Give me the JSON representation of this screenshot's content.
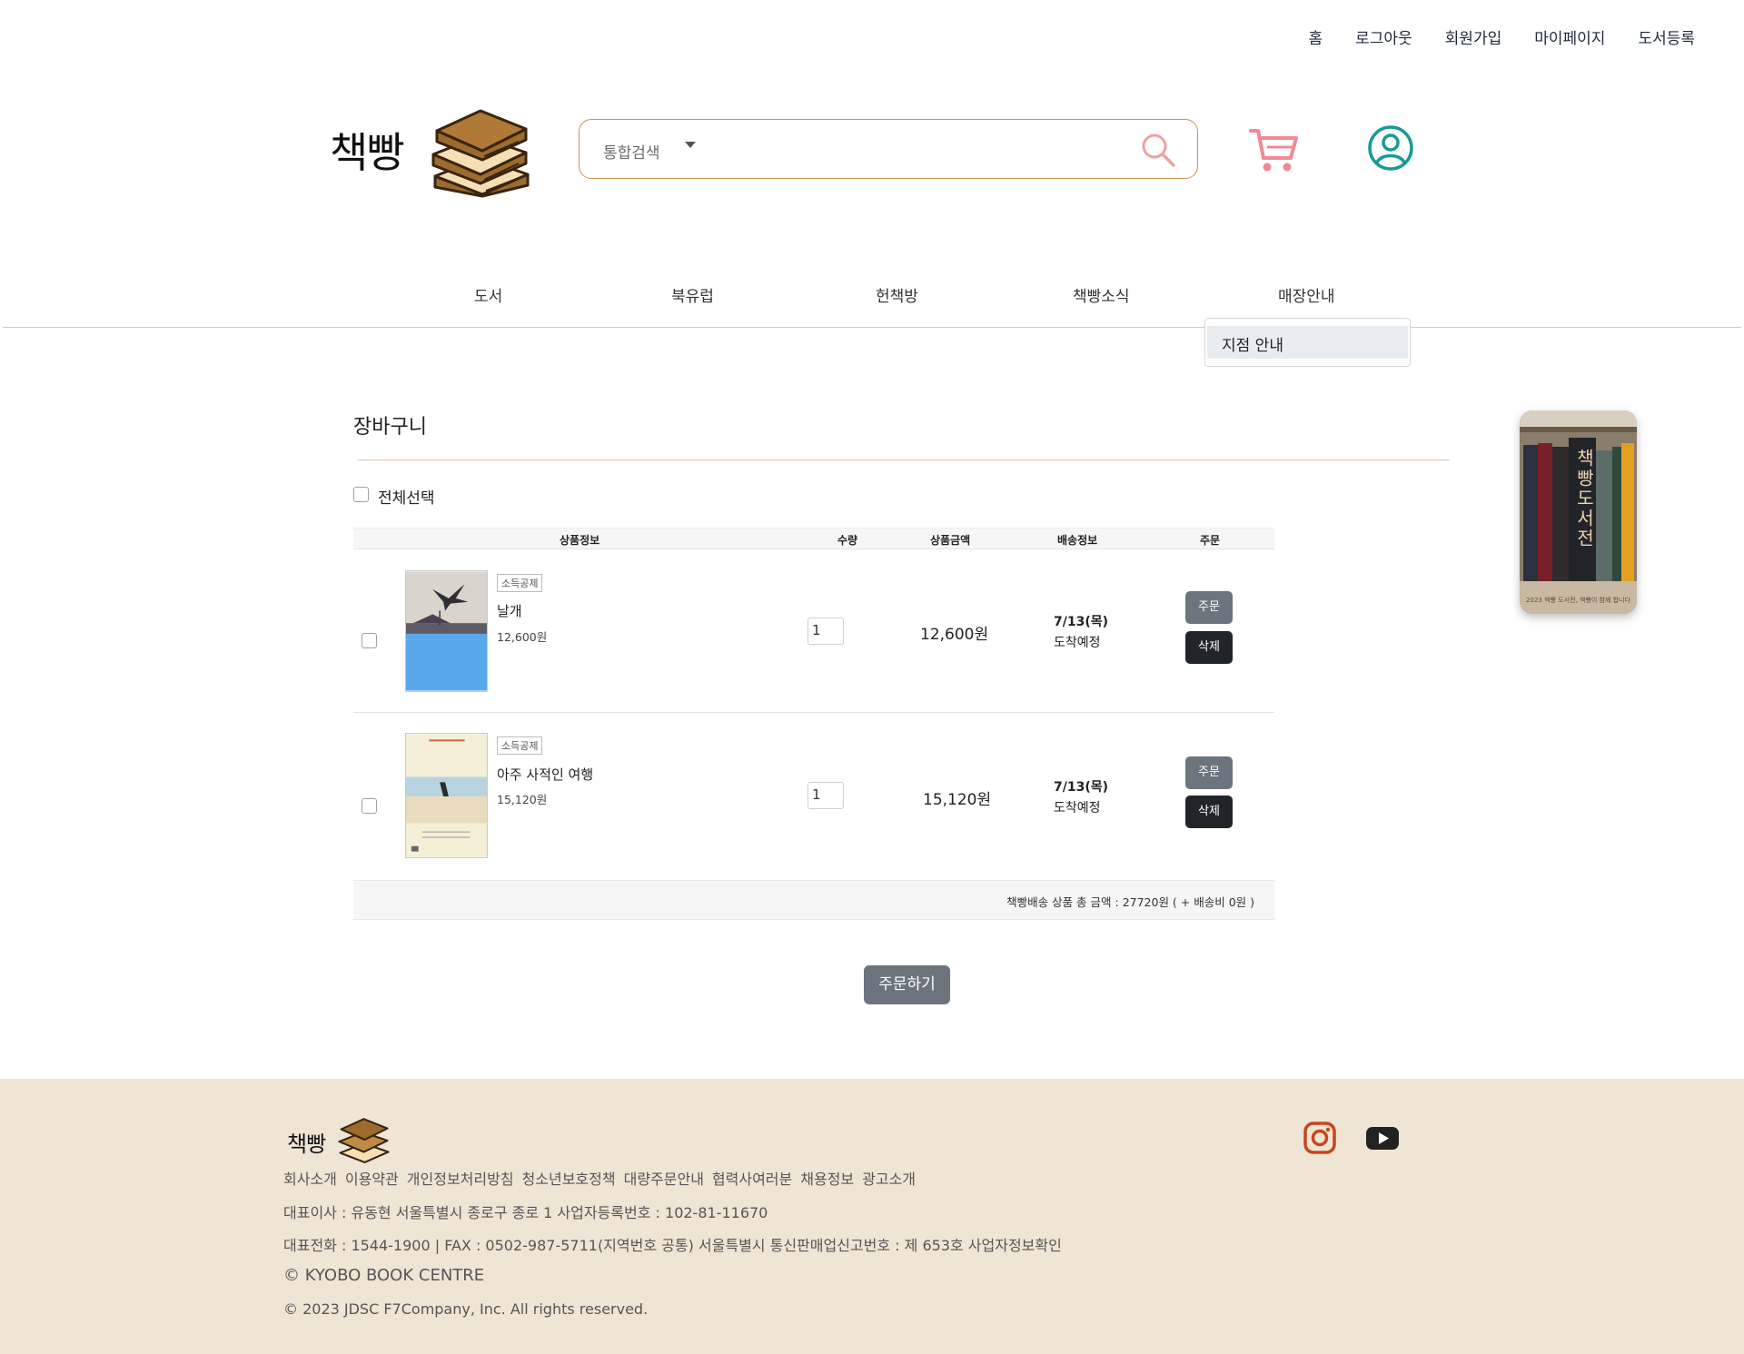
{
  "top_links": [
    "홈",
    "로그아웃",
    "회원가입",
    "마이페이지",
    "도서등록"
  ],
  "logo_text": "책빵",
  "search": {
    "category": "통합검색",
    "placeholder": ""
  },
  "nav": [
    "도서",
    "북유럽",
    "헌책방",
    "책빵소식",
    "매장안내"
  ],
  "dropdown": {
    "item": "지점 안내"
  },
  "cart": {
    "title": "장바구니",
    "select_all": "전체선택",
    "columns": [
      "상품정보",
      "수량",
      "상품금액",
      "배송정보",
      "주문"
    ],
    "items": [
      {
        "tag": "소득공제",
        "name": "날개",
        "price": "12,600원",
        "qty": "1",
        "amount": "12,600원",
        "ship_date": "7/13(목)",
        "ship_label": "도착예정",
        "order_btn": "주문",
        "delete_btn": "삭제"
      },
      {
        "tag": "소득공제",
        "name": "아주 사적인 여행",
        "price": "15,120원",
        "qty": "1",
        "amount": "15,120원",
        "ship_date": "7/13(목)",
        "ship_label": "도착예정",
        "order_btn": "주문",
        "delete_btn": "삭제"
      }
    ],
    "total": "책빵배송 상품 총 금액 : 27720원 ( + 배송비 0원 )",
    "checkout": "주문하기"
  },
  "promo": {
    "title": "책빵도서전",
    "caption": "2023 책빵 도서전, 책빵이 함께 합니다"
  },
  "footer": {
    "logo_text": "책빵",
    "links": [
      "회사소개",
      "이용약관",
      "개인정보처리방침",
      "청소년보호정책",
      "대량주문안내",
      "협력사여러분",
      "채용정보",
      "광고소개"
    ],
    "line1": "대표이사 : 유동현 서울특별시 종로구 종로 1 사업자등록번호 : 102-81-11670",
    "line2": "대표전화 : 1544-1900 | FAX : 0502-987-5711(지역번호 공통) 서울특별시 통신판매업신고번호 : 제 653호 사업자정보확인",
    "line3": "© KYOBO BOOK CENTRE",
    "line4": "© 2023 JDSC F7Company, Inc. All rights reserved."
  },
  "colors": {
    "accent": "#c89454",
    "cart_icon": "#f08a94",
    "user_icon": "#1a9a94",
    "footer_bg": "#efe5d5",
    "instagram": "#c8461c"
  },
  "icons": [
    "search-icon",
    "cart-icon",
    "user-icon",
    "instagram-icon",
    "youtube-icon"
  ]
}
